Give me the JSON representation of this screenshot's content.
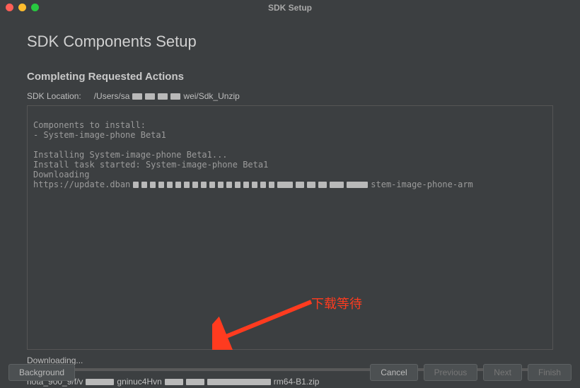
{
  "window": {
    "title": "SDK Setup"
  },
  "page": {
    "heading": "SDK Components Setup",
    "subheading": "Completing Requested Actions"
  },
  "sdk": {
    "label": "SDK Location:",
    "path_prefix": "/Users/sa",
    "path_suffix": "wei/Sdk_Unzip"
  },
  "console": {
    "line1": "Components to install:",
    "line2": "- System-image-phone Beta1",
    "line3": "",
    "line4": "Installing System-image-phone Beta1...",
    "line5": "Install task started: System-image-phone Beta1",
    "line6": "Downloading",
    "url_prefix": "https://update.dban",
    "url_suffix": "stem-image-phone-arm"
  },
  "progress": {
    "status": "Downloading...",
    "percent": 0.3,
    "file_prefix": "hota_900_9/f/v",
    "file_mid": "gninuc4Hvn",
    "file_suffix": "rm64-B1.zip"
  },
  "buttons": {
    "background": "Background",
    "cancel": "Cancel",
    "previous": "Previous",
    "next": "Next",
    "finish": "Finish"
  },
  "annotation": {
    "text": "下载等待"
  }
}
